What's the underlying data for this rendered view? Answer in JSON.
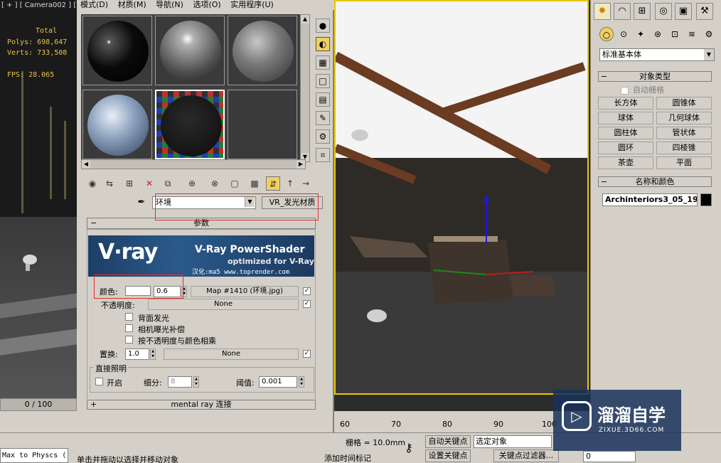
{
  "viewport_left": {
    "label": "[ + ] [ Camera002 ] [",
    "total_label": "Total",
    "polys": "Polys: 698,647",
    "verts": "Verts: 733,508",
    "fps": "FPS:   28.065"
  },
  "menu": [
    "模式(D)",
    "材质(M)",
    "导航(N)",
    "选项(O)",
    "实用程序(U)"
  ],
  "material_editor": {
    "material_name": "环境",
    "material_type": "VR_发光材质",
    "params_title": "参数",
    "vray_banner": {
      "logo": "V·ray",
      "title": "V-Ray PowerShader",
      "subtitle": "optimized for V-Ray",
      "credit": "汉化:ma5 www.toprender.com"
    },
    "color_label": "颜色:",
    "color_value": "0.6",
    "color_map": "Map #1410 (环境.jpg)",
    "opacity_label": "不透明度:",
    "opacity_map": "None",
    "option_backside": "背面发光",
    "option_exposure": "相机曝光补偿",
    "option_multiply": "按不透明度与颜色相乘",
    "displace_label": "置换:",
    "displace_value": "1.0",
    "displace_map": "None",
    "direct_group_title": "直接照明",
    "direct_on_label": "开启",
    "subdiv_label": "细分:",
    "subdiv_value": "8",
    "threshold_label": "阈值:",
    "threshold_value": "0.001",
    "mentalray_label": "mental ray 连接"
  },
  "command_panel": {
    "category": "标准基本体",
    "object_type_title": "对象类型",
    "autogrid_label": "自动栅格",
    "objects": [
      "长方体",
      "圆锥体",
      "球体",
      "几何球体",
      "圆柱体",
      "管状体",
      "圆环",
      "四棱锥",
      "茶壶",
      "平面"
    ],
    "name_color_title": "名称和颜色",
    "object_name": "Archinteriors3_05_19:"
  },
  "timeline": {
    "frame_range": "0 / 100",
    "ticks": [
      "60",
      "70",
      "80",
      "90",
      "100"
    ]
  },
  "status": {
    "listener": "Max to Physcs (",
    "prompt": "单击并拖动以选择并移动对象",
    "grid": "栅格 = 10.0mm",
    "add_time_tag": "添加时间标记",
    "auto_key": "自动关键点",
    "set_key": "设置关键点",
    "selection": "选定对象",
    "key_filters": "关键点过滤器...",
    "frame": "0"
  },
  "watermark": {
    "title": "溜溜自学",
    "url": "ZIXUE.3D66.COM"
  }
}
